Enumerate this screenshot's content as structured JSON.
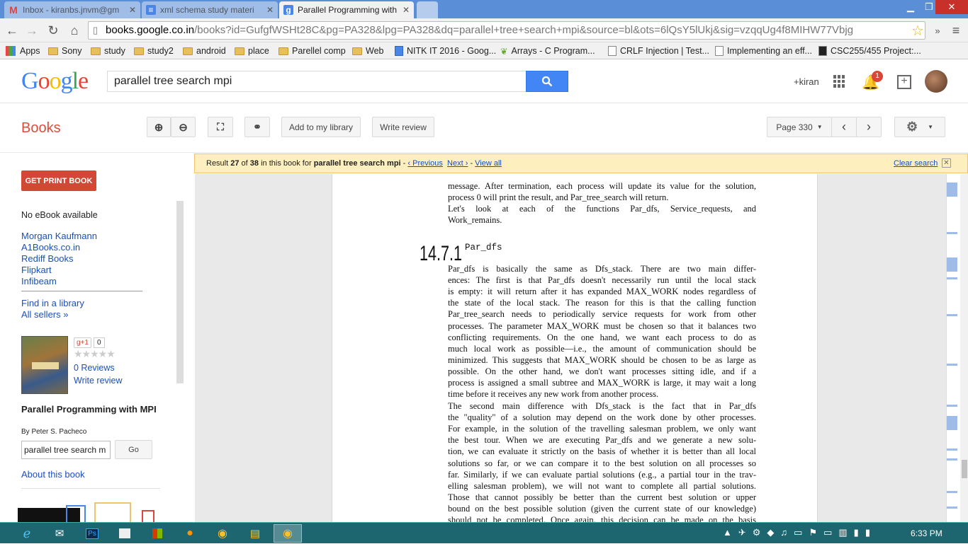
{
  "tabs": [
    {
      "title": "Inbox - kiranbs.jnvm@gm",
      "icon": "gmail-icon"
    },
    {
      "title": "xml schema study materi",
      "icon": "docs-icon"
    },
    {
      "title": "Parallel Programming with",
      "icon": "google-icon"
    }
  ],
  "address": {
    "host": "books.google.co.in",
    "path": "/books?id=GufgfWSHt28C&pg=PA328&lpg=PA328&dq=parallel+tree+search+mpi&source=bl&ots=6lQsY5lUkj&sig=vzqqUg4f8MIHW77Vbjg"
  },
  "bookmarks": [
    "Apps",
    "Sony",
    "study",
    "study2",
    "android",
    "place",
    "Parellel comp",
    "Web",
    "NITK IT 2016 - Goog...",
    "Arrays - C Program...",
    "CRLF Injection | Test...",
    "Implementing an eff...",
    "CSC255/455 Project:..."
  ],
  "header": {
    "logo": "Google",
    "search_value": "parallel tree search mpi",
    "user": "+kiran",
    "notifications": "1"
  },
  "books": {
    "title": "Books",
    "add_library": "Add to my library",
    "write_review": "Write review",
    "page_label": "Page 330"
  },
  "notice": {
    "prefix": "Result ",
    "result_num": "27",
    "of": " of ",
    "total": "38",
    "mid": " in this book for ",
    "query": "parallel tree search mpi",
    "dash1": " - ",
    "previous": "‹ Previous",
    "next": "Next ›",
    "dash2": " - ",
    "view_all": "View all",
    "clear": "Clear search"
  },
  "left": {
    "get_print": "GET PRINT BOOK",
    "no_ebook": "No eBook available",
    "sellers": [
      "Morgan Kaufmann",
      "A1Books.co.in",
      "Rediff Books",
      "Flipkart",
      "Infibeam"
    ],
    "find_library": "Find in a library",
    "all_sellers": "All sellers »",
    "gplus": "g+1",
    "gplus_count": "0",
    "stars": "★★★★★",
    "reviews": "0 Reviews",
    "write_review": "Write review",
    "book_title": "Parallel Programming with MPI",
    "author": "By Peter S. Pacheco",
    "search_in_book": "parallel tree search m",
    "go": "Go",
    "about": "About this book"
  },
  "page_text": {
    "lines_top": [
      "message.  After termination, each process will update its value for the solution,",
      "process 0 will print the result, and Par_tree_search will return.",
      "     Let's look at each of the functions Par_dfs, Service_requests, and",
      "Work_remains."
    ],
    "section_number": "14.7.1",
    "section_title": "Par_dfs",
    "para1": [
      "     Par_dfs is basically the same as Dfs_stack. There are two main differ-",
      "ences: The first is that Par_dfs doesn't necessarily run until the local stack",
      "is empty: it will return after it has expanded MAX_WORK nodes regardless of",
      "the state of the local stack.  The reason for this is that the calling function",
      "Par_tree_search needs to periodically service requests for work from other",
      "processes.  The parameter MAX_WORK must be chosen so that it balances two",
      "conflicting requirements.  On the one hand, we want each process to do as",
      "much local work as possible—i.e., the amount of communication should be",
      "minimized.  This suggests that MAX_WORK should be chosen to be as large as",
      "possible.  On the other hand, we don't want processes sitting idle, and if a",
      "process is assigned a small subtree and MAX_WORK is large, it may wait a long",
      "time before it receives any new work from another process."
    ],
    "para2": [
      "     The second main difference with Dfs_stack is the fact that in Par_dfs",
      "the \"quality\" of a solution may depend on the work done by other processes.",
      "For example, in the solution of the travelling salesman problem, we only want",
      "the best tour.  When we are executing Par_dfs and we generate a new solu-",
      "tion, we can evaluate it strictly on the basis of whether it is better than all local",
      "solutions so far, or we can compare it to the best solution on all processes so",
      "far.  Similarly, if we can evaluate partial solutions (e.g., a partial tour in the trav-",
      "elling salesman problem), we will not want to complete all partial solutions.",
      "Those that cannot possibly be better than the current best solution or upper",
      "bound on the best possible solution (given the current state of our knowledge)",
      "should not be completed.  Once again, this decision can be made on the basis"
    ]
  },
  "taskbar": {
    "time": "6:33 PM"
  },
  "colors": {
    "accent": "#4285f4",
    "books_red": "#dd4b39",
    "notice_bg": "#fdefbe",
    "taskbar": "#1d6670"
  }
}
